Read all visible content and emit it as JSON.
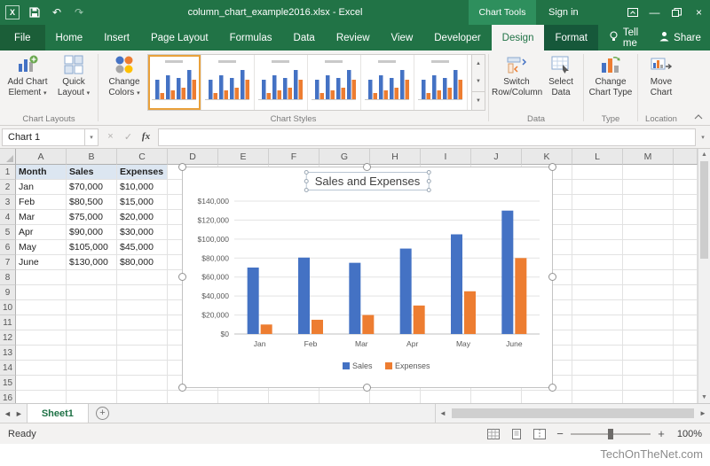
{
  "window": {
    "title": "column_chart_example2016.xlsx - Excel",
    "contextual_tool": "Chart Tools",
    "sign_in_label": "Sign in"
  },
  "ribbon": {
    "tabs": [
      "File",
      "Home",
      "Insert",
      "Page Layout",
      "Formulas",
      "Data",
      "Review",
      "View",
      "Developer",
      "Design",
      "Format"
    ],
    "active_tab": "Design",
    "contextual_tabs": [
      "Design",
      "Format"
    ],
    "tell_me": "Tell me",
    "share": "Share",
    "chart_layouts": {
      "label": "Chart Layouts",
      "add_chart_element": "Add Chart Element",
      "quick_layout": "Quick Layout"
    },
    "chart_styles": {
      "label": "Chart Styles",
      "change_colors": "Change Colors",
      "visible_count": 6,
      "selected_index": 0
    },
    "data_group": {
      "label": "Data",
      "switch_row_column": "Switch Row/Column",
      "select_data": "Select Data"
    },
    "type_group": {
      "label": "Type",
      "change_chart_type": "Change Chart Type"
    },
    "location_group": {
      "label": "Location",
      "move_chart": "Move Chart"
    }
  },
  "formula_bar": {
    "name_box": "Chart 1",
    "fx": "fx",
    "value": ""
  },
  "sheet": {
    "columns": [
      "A",
      "B",
      "C",
      "D",
      "E",
      "F",
      "G",
      "H",
      "I",
      "J",
      "K",
      "L",
      "M"
    ],
    "visible_row_count": 16,
    "header_row": [
      "Month",
      "Sales",
      "Expenses"
    ],
    "rows": [
      [
        "Jan",
        "$70,000",
        "$10,000"
      ],
      [
        "Feb",
        "$80,500",
        "$15,000"
      ],
      [
        "Mar",
        "$75,000",
        "$20,000"
      ],
      [
        "Apr",
        "$90,000",
        "$30,000"
      ],
      [
        "May",
        "$105,000",
        "$45,000"
      ],
      [
        "June",
        "$130,000",
        "$80,000"
      ]
    ]
  },
  "chart_data": {
    "type": "bar",
    "title": "Sales and Expenses",
    "categories": [
      "Jan",
      "Feb",
      "Mar",
      "Apr",
      "May",
      "June"
    ],
    "series": [
      {
        "name": "Sales",
        "color": "#4472c4",
        "values": [
          70000,
          80500,
          75000,
          90000,
          105000,
          130000
        ]
      },
      {
        "name": "Expenses",
        "color": "#ed7d31",
        "values": [
          10000,
          15000,
          20000,
          30000,
          45000,
          80000
        ]
      }
    ],
    "ylim": [
      0,
      140000
    ],
    "y_ticks": [
      0,
      20000,
      40000,
      60000,
      80000,
      100000,
      120000,
      140000
    ],
    "y_tick_labels": [
      "$0",
      "$20,000",
      "$40,000",
      "$60,000",
      "$80,000",
      "$100,000",
      "$120,000",
      "$140,000"
    ],
    "gridlines": true,
    "legend_position": "bottom"
  },
  "sheet_tabs": {
    "tabs": [
      "Sheet1"
    ],
    "active": "Sheet1"
  },
  "status_bar": {
    "mode": "Ready",
    "zoom": "100%"
  },
  "watermark": "TechOnTheNet.com",
  "colors": {
    "excel_green": "#217346",
    "sales": "#4472c4",
    "expenses": "#ed7d31"
  }
}
